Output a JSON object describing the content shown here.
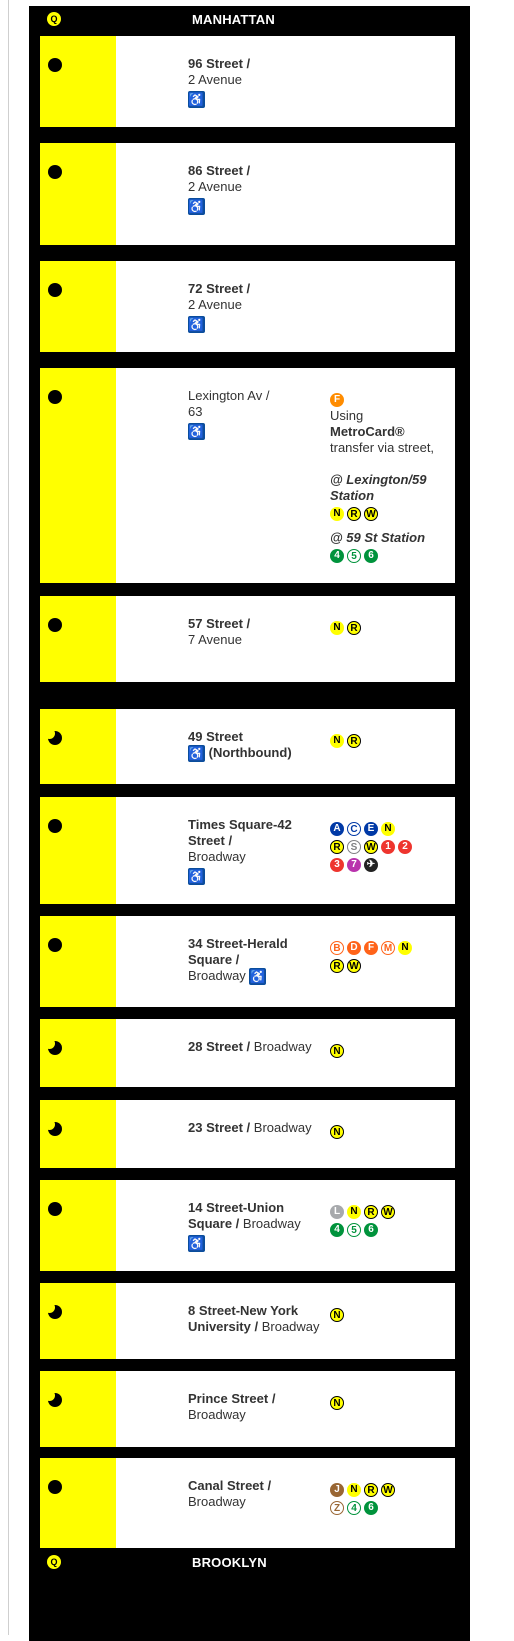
{
  "header": {
    "borough": "MANHATTAN",
    "route": "Q",
    "route_color": "#ffff00"
  },
  "footer": {
    "borough": "BROOKLYN",
    "route": "Q"
  },
  "colors": {
    "yellow": "#ffff00",
    "accessible": "#0a4d9c"
  },
  "stations": [
    {
      "name_bold": "96 Street /",
      "name_rest": "2 Avenue",
      "accessible": true,
      "stop": "full",
      "transfers": []
    },
    {
      "name_bold": "86 Street /",
      "name_rest": "2 Avenue",
      "accessible": true,
      "stop": "full",
      "transfers": []
    },
    {
      "name_bold": "72 Street /",
      "name_rest": "2 Avenue",
      "accessible": true,
      "stop": "full",
      "transfers": []
    },
    {
      "name_plain": "Lexington Av /",
      "name_rest": "63",
      "accessible": true,
      "stop": "full",
      "transfer_route": "F",
      "note_pre": "Using",
      "note_bold": "MetroCard®",
      "note_post": "transfer via street,",
      "alt1": "@ Lexington/59 Station",
      "alt1_routes": [
        "N",
        "R",
        "W"
      ],
      "alt2": "@ 59 St Station",
      "alt2_routes": [
        "4",
        "5",
        "6"
      ]
    },
    {
      "name_bold": "57 Street /",
      "name_rest": "7 Avenue",
      "accessible": false,
      "stop": "full",
      "transfers": [
        "N",
        "R"
      ]
    },
    {
      "name_bold": "49 Street",
      "acc_note": "(Northbound)",
      "accessible": true,
      "stop": "part",
      "transfers": [
        "N",
        "R"
      ]
    },
    {
      "name_bold": "Times Square-42 Street /",
      "name_rest": "Broadway",
      "accessible": true,
      "stop": "full",
      "transfers": [
        "A",
        "C",
        "E",
        "N",
        "R",
        "S",
        "W",
        "1",
        "2",
        "3",
        "7",
        "✈"
      ]
    },
    {
      "name_bold": "34 Street-Herald Square /",
      "name_rest": "Broadway",
      "accessible": true,
      "stop": "full",
      "transfers": [
        "B",
        "D",
        "F",
        "M",
        "N",
        "R",
        "W"
      ]
    },
    {
      "name_bold": "28 Street /",
      "name_inline": "Broadway",
      "accessible": false,
      "stop": "part",
      "transfers": [
        "N"
      ]
    },
    {
      "name_bold": "23 Street /",
      "name_inline": "Broadway",
      "accessible": false,
      "stop": "part",
      "transfers": [
        "N"
      ]
    },
    {
      "name_bold": "14 Street-Union Square /",
      "name_inline": "Broadway",
      "accessible": true,
      "stop": "full",
      "transfers": [
        "L",
        "N",
        "R",
        "W",
        "4",
        "5",
        "6"
      ]
    },
    {
      "name_bold": "8 Street-New York University /",
      "name_inline": "Broadway",
      "accessible": false,
      "stop": "part",
      "transfers": [
        "N"
      ]
    },
    {
      "name_bold": "Prince Street /",
      "name_rest": "Broadway",
      "accessible": false,
      "stop": "part",
      "transfers": [
        "N"
      ]
    },
    {
      "name_bold": "Canal Street /",
      "name_rest": "Broadway",
      "accessible": false,
      "stop": "full",
      "transfers": [
        "J",
        "N",
        "R",
        "W",
        "Z",
        "4",
        "6"
      ]
    }
  ]
}
